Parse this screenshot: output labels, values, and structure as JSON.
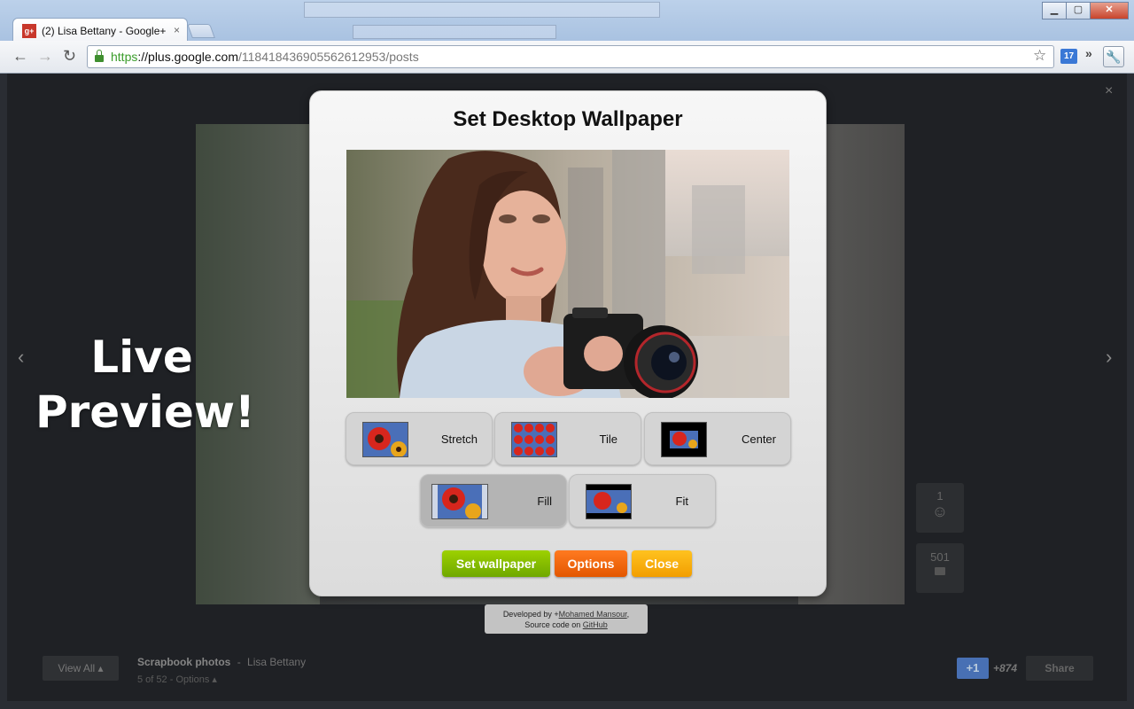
{
  "browser": {
    "tab_title": "(2) Lisa Bettany - Google+",
    "tab_close": "×",
    "window_buttons": {
      "minimize": "▁",
      "maximize": "▢",
      "close": "✕"
    },
    "url_https": "https",
    "url_host": "://plus.google.com",
    "url_path": "/118418436905562612953/posts",
    "calendar_badge": "17",
    "extensions_chevron": "»"
  },
  "lightbox": {
    "close": "×",
    "prev_arrow": "‹",
    "next_arrow": "›",
    "overlay_text_line1": "Live",
    "overlay_text_line2": "Preview!",
    "plus_count_side": "1",
    "comment_count_side": "501",
    "view_all": "View All ▴",
    "album_title": "Scrapbook photos",
    "album_author": "Lisa Bettany",
    "album_position": "5 of 52",
    "album_options": "Options ▴",
    "plus_one": "+1",
    "plus_count": "+874",
    "share": "Share"
  },
  "dialog": {
    "title": "Set Desktop Wallpaper",
    "modes": [
      {
        "label": "Stretch",
        "active": false
      },
      {
        "label": "Tile",
        "active": false
      },
      {
        "label": "Center",
        "active": false
      },
      {
        "label": "Fill",
        "active": true
      },
      {
        "label": "Fit",
        "active": false
      }
    ],
    "buttons": {
      "set_wallpaper": "Set wallpaper",
      "options": "Options",
      "close": "Close"
    }
  },
  "credit": {
    "developed_by": "Developed by +",
    "author_link": "Mohamed Mansour",
    "comma": ",",
    "source_text": "Source code on ",
    "source_link": "GitHub"
  },
  "colors": {
    "green_button": "#8cc400",
    "orange_button": "#f26a0f",
    "yellow_button": "#fbb014"
  }
}
